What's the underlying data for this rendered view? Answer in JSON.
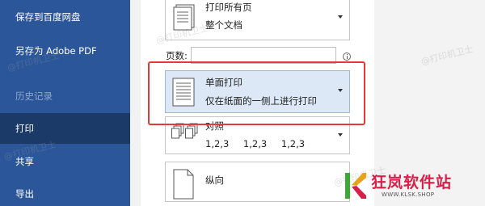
{
  "sidebar": {
    "items": [
      {
        "label": "保存到百度网盘",
        "state": "normal"
      },
      {
        "label": "另存为 Adobe PDF",
        "state": "normal"
      },
      {
        "label": "历史记录",
        "state": "disabled"
      },
      {
        "label": "打印",
        "state": "selected"
      },
      {
        "label": "共享",
        "state": "normal"
      },
      {
        "label": "导出",
        "state": "normal"
      }
    ]
  },
  "settings": {
    "print_range": {
      "title": "打印所有页",
      "subtitle": "整个文档"
    },
    "pages": {
      "label": "页数:",
      "value": "",
      "info_icon": "info-icon"
    },
    "sides": {
      "title": "单面打印",
      "subtitle": "仅在纸面的一侧上进行打印"
    },
    "collation": {
      "title": "对照",
      "subtitle": "1,2,3 1,2,3 1,2,3"
    },
    "orientation": {
      "title": "纵向"
    }
  },
  "annotation": {
    "color": "#e53935"
  },
  "watermark": {
    "text": "@打印机卫士"
  },
  "logo": {
    "text": "狂岚软件站",
    "subtext": "WWW.KLSK.SHOP",
    "brand_color": "#d91e48"
  },
  "colors": {
    "sidebar": "#2b579a",
    "sidebar_selected": "#1b3a67",
    "selected_dropdown": "#dde8f7"
  }
}
